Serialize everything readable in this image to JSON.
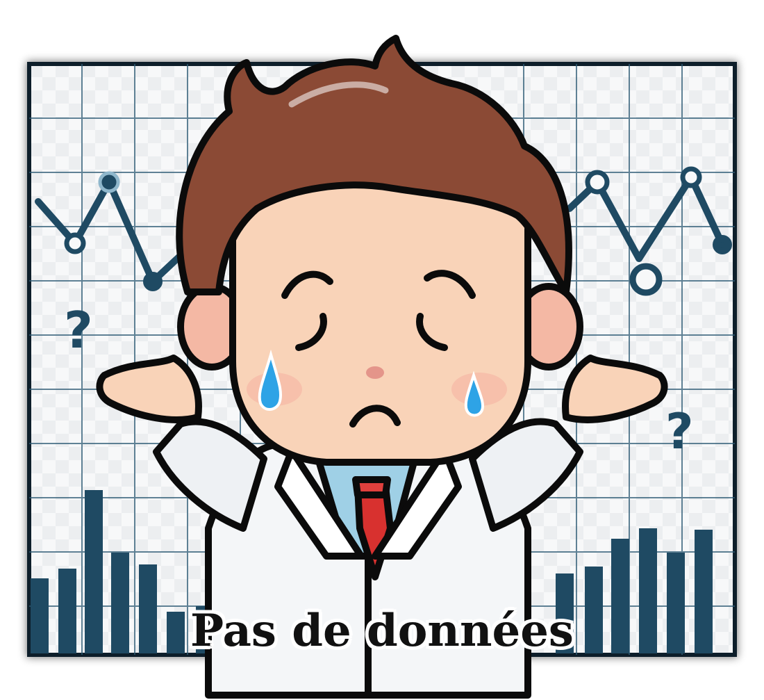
{
  "caption": "Pas de données",
  "colors": {
    "chart_ink": "#1f4a63",
    "grid_line": "#2d5a74",
    "hair": "#8b4a35",
    "skin": "#f9d3b8",
    "tear": "#2ea3e6",
    "tie": "#d8312f",
    "coat": "#f4f6f8"
  },
  "icons": [
    "question-mark-icon",
    "tear-icon",
    "line-chart-icon",
    "bar-chart-icon"
  ]
}
